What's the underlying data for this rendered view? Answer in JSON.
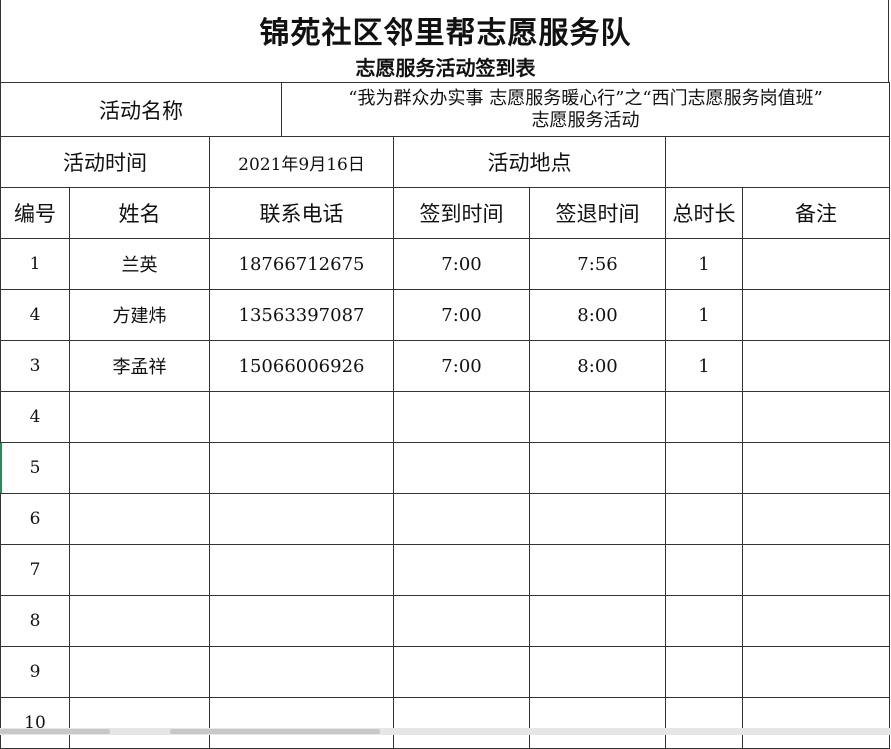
{
  "title": "锦苑社区邻里帮志愿服务队",
  "subtitle": "志愿服务活动签到表",
  "activity": {
    "name_label": "活动名称",
    "name_line1": "“我为群众办实事 志愿服务暖心行”之“西门志愿服务岗值班”",
    "name_line2": "志愿服务活动",
    "time_label": "活动时间",
    "time_value": "2021年9月16日",
    "place_label": "活动地点",
    "place_value": ""
  },
  "columns": [
    "编号",
    "姓名",
    "联系电话",
    "签到时间",
    "签退时间",
    "总时长",
    "备注"
  ],
  "rows": [
    {
      "no": "1",
      "name": "兰英",
      "phone": "18766712675",
      "in": "7:00",
      "out": "7:56",
      "hours": "1",
      "note": ""
    },
    {
      "no": "4",
      "name": "方建炜",
      "phone": "13563397087",
      "in": "7:00",
      "out": "8:00",
      "hours": "1",
      "note": ""
    },
    {
      "no": "3",
      "name": "李孟祥",
      "phone": "15066006926",
      "in": "7:00",
      "out": "8:00",
      "hours": "1",
      "note": ""
    },
    {
      "no": "4",
      "name": "",
      "phone": "",
      "in": "",
      "out": "",
      "hours": "",
      "note": ""
    },
    {
      "no": "5",
      "name": "",
      "phone": "",
      "in": "",
      "out": "",
      "hours": "",
      "note": ""
    },
    {
      "no": "6",
      "name": "",
      "phone": "",
      "in": "",
      "out": "",
      "hours": "",
      "note": ""
    },
    {
      "no": "7",
      "name": "",
      "phone": "",
      "in": "",
      "out": "",
      "hours": "",
      "note": ""
    },
    {
      "no": "8",
      "name": "",
      "phone": "",
      "in": "",
      "out": "",
      "hours": "",
      "note": ""
    },
    {
      "no": "9",
      "name": "",
      "phone": "",
      "in": "",
      "out": "",
      "hours": "",
      "note": ""
    },
    {
      "no": "10",
      "name": "",
      "phone": "",
      "in": "",
      "out": "",
      "hours": "",
      "note": ""
    }
  ]
}
